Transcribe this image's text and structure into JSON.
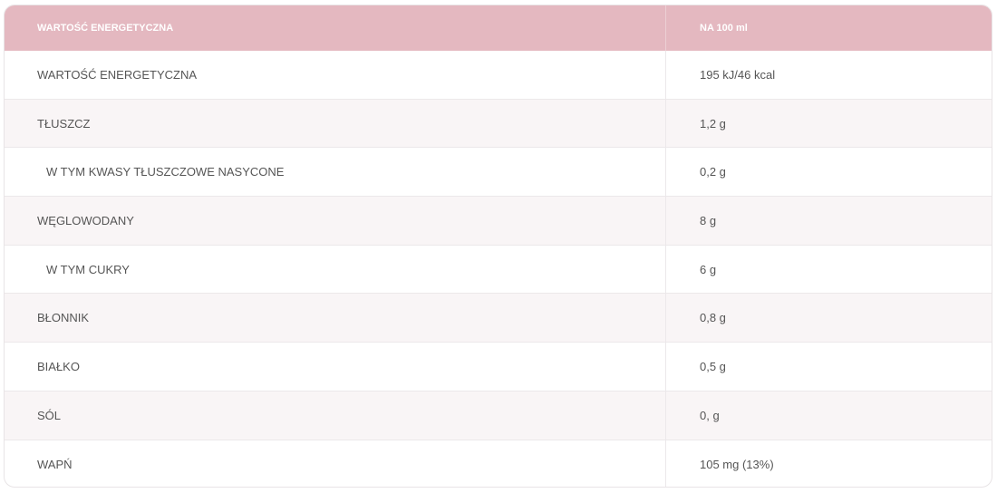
{
  "table": {
    "header": {
      "name": "WARTOŚĆ ENERGETYCZNA",
      "value": "NA 100 ml"
    },
    "rows": [
      {
        "name": "WARTOŚĆ ENERGETYCZNA",
        "value": "195 kJ/46 kcal"
      },
      {
        "name": "TŁUSZCZ",
        "value": "1,2 g"
      },
      {
        "name": "W TYM KWASY TŁUSZCZOWE NASYCONE",
        "value": "0,2 g"
      },
      {
        "name": "WĘGLOWODANY",
        "value": "8 g"
      },
      {
        "name": "W TYM CUKRY",
        "value": "6 g"
      },
      {
        "name": "BŁONNIK",
        "value": "0,8 g"
      },
      {
        "name": "BIAŁKO",
        "value": "0,5 g"
      },
      {
        "name": "SÓL",
        "value": "0, g"
      },
      {
        "name": "WAPŃ",
        "value": "105 mg (13%)"
      }
    ]
  },
  "colors": {
    "header_bg": "#e4b8c0",
    "alt_row_bg": "#f9f5f6",
    "text": "#555555"
  }
}
